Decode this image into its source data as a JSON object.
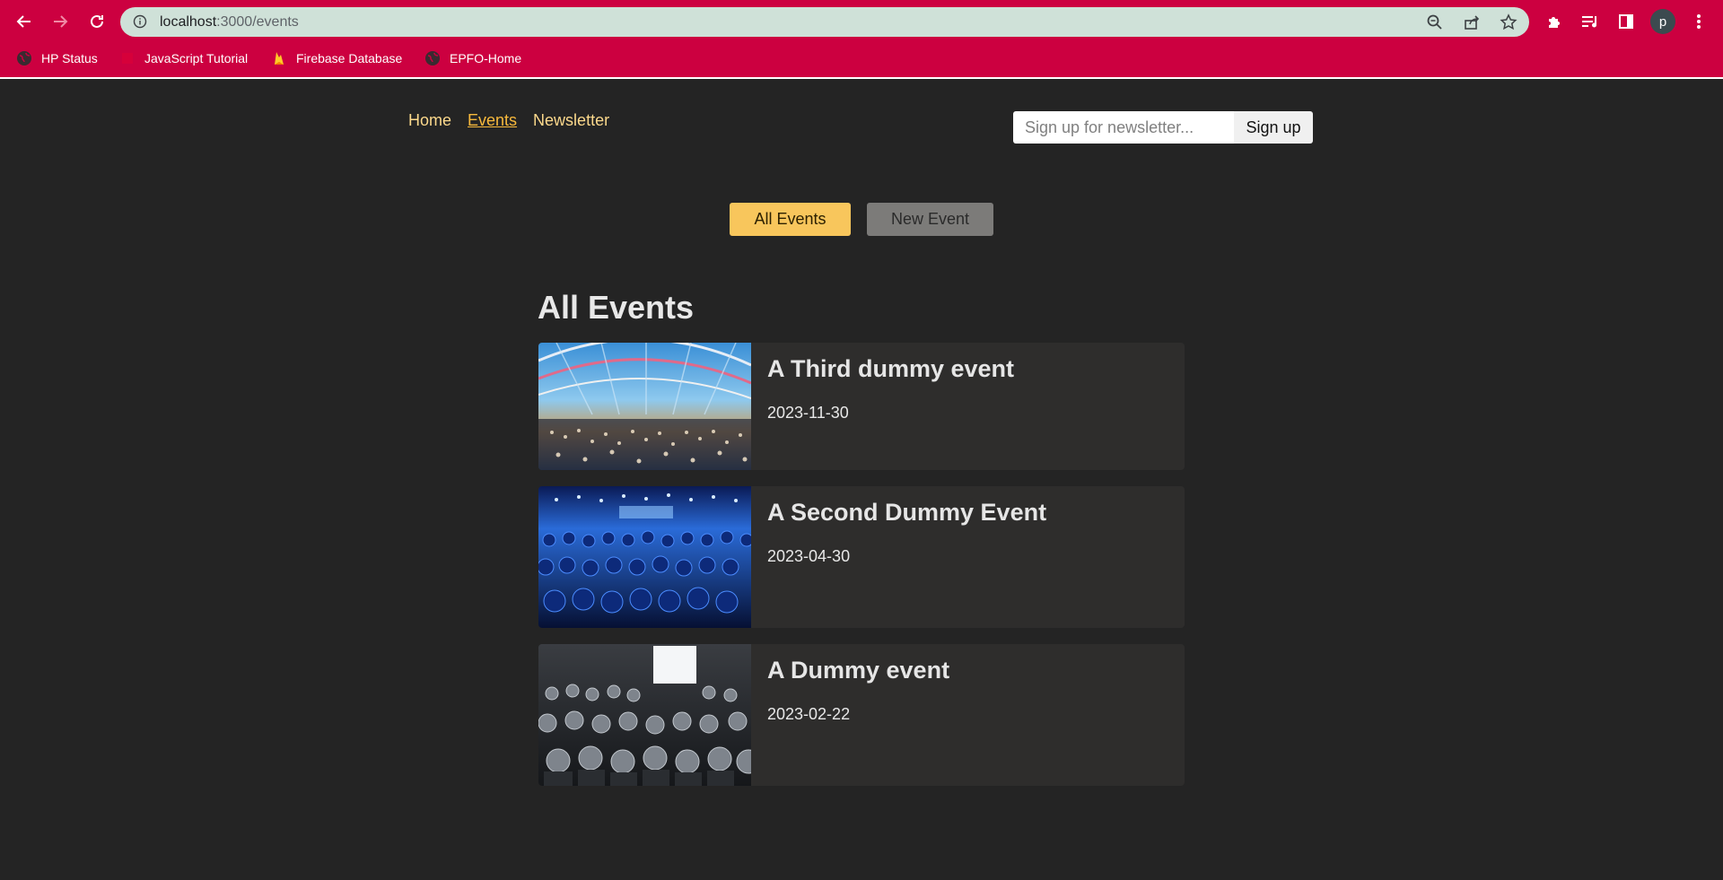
{
  "browser": {
    "url_host": "localhost",
    "url_path": ":3000/events",
    "avatar_letter": "p",
    "bookmarks": [
      {
        "label": "HP Status",
        "icon": "globe-icon"
      },
      {
        "label": "JavaScript Tutorial",
        "icon": "js-icon"
      },
      {
        "label": "Firebase Database",
        "icon": "firebase-icon"
      },
      {
        "label": "EPFO-Home",
        "icon": "globe-icon"
      }
    ]
  },
  "nav": {
    "items": [
      {
        "label": "Home",
        "active": false
      },
      {
        "label": "Events",
        "active": true
      },
      {
        "label": "Newsletter",
        "active": false
      }
    ]
  },
  "newsletter": {
    "placeholder": "Sign up for newsletter...",
    "button_label": "Sign up"
  },
  "events_nav": {
    "all_label": "All Events",
    "new_label": "New Event"
  },
  "page": {
    "heading": "All Events"
  },
  "events": [
    {
      "title": "A Third dummy event",
      "date": "2023-11-30",
      "image": "conference-hall-photo"
    },
    {
      "title": "A Second Dummy Event",
      "date": "2023-04-30",
      "image": "blue-audience-photo"
    },
    {
      "title": "A Dummy event",
      "date": "2023-02-22",
      "image": "grayscale-audience-photo"
    }
  ],
  "colors": {
    "chrome": "#cc0040",
    "page_bg": "#242424",
    "accent": "#f8c65c",
    "card_bg": "#2e2d2c"
  }
}
